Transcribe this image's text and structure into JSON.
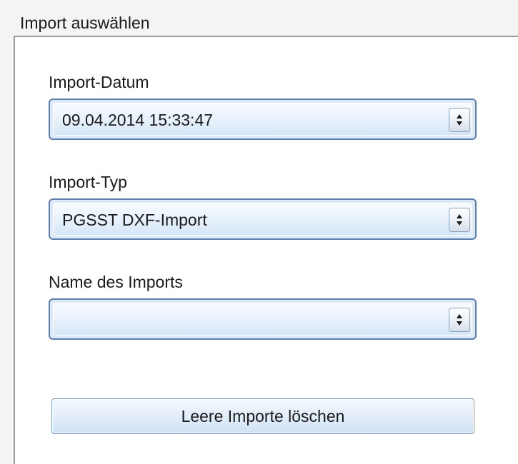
{
  "panel": {
    "title": "Import auswählen"
  },
  "fields": {
    "import_date": {
      "label": "Import-Datum",
      "value": "09.04.2014 15:33:47"
    },
    "import_type": {
      "label": "Import-Typ",
      "value": "PGSST DXF-Import"
    },
    "import_name": {
      "label": "Name des Imports",
      "value": ""
    }
  },
  "actions": {
    "delete_empty_label": "Leere Importe löschen"
  },
  "icons": {
    "dropdown_spinner": "updown-arrows-icon"
  },
  "colors": {
    "accent_border": "#5d7fae",
    "field_background": "#dbe9f8"
  }
}
